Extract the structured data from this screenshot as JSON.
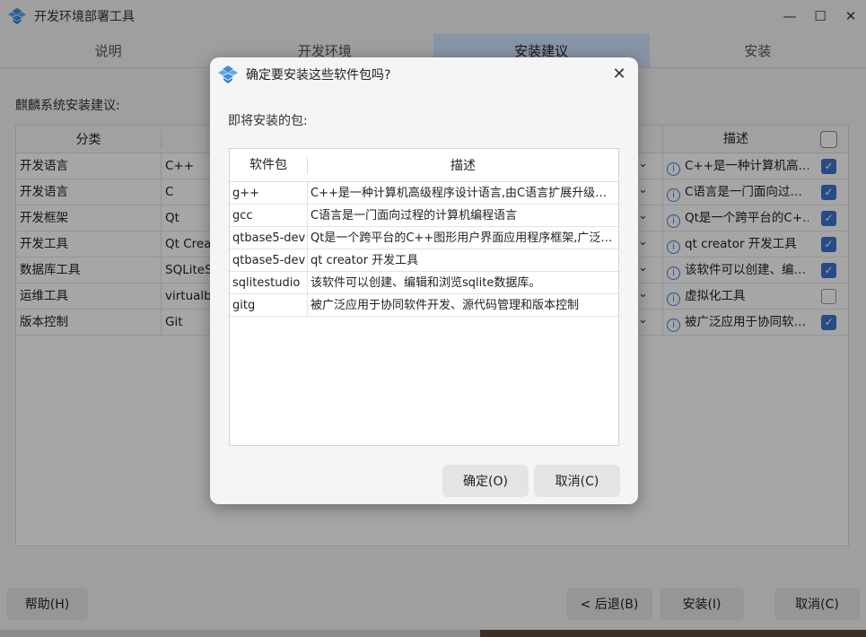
{
  "window": {
    "title": "开发环境部署工具"
  },
  "tabs": [
    {
      "label": "说明"
    },
    {
      "label": "开发环境"
    },
    {
      "label": "安装建议"
    },
    {
      "label": "安装"
    }
  ],
  "section_label": "麒麟系统安装建议:",
  "grid": {
    "headers": {
      "category": "分类",
      "description": "描述"
    },
    "rows": [
      {
        "category": "开发语言",
        "software": "C++",
        "desc": "C++是一种计算机高…",
        "checked": true
      },
      {
        "category": "开发语言",
        "software": "C",
        "desc": "C语言是一门面向过…",
        "checked": true
      },
      {
        "category": "开发框架",
        "software": "Qt",
        "desc": "Qt是一个跨平台的C+…",
        "checked": true
      },
      {
        "category": "开发工具",
        "software": "Qt Creat",
        "desc": "qt creator 开发工具",
        "checked": true
      },
      {
        "category": "数据库工具",
        "software": "SQLiteSt",
        "desc": "该软件可以创建、编…",
        "checked": true
      },
      {
        "category": "运维工具",
        "software": "virtualbo",
        "desc": "虚拟化工具",
        "checked": false
      },
      {
        "category": "版本控制",
        "software": "Git",
        "desc": "被广泛应用于协同软…",
        "checked": true
      }
    ]
  },
  "buttons": {
    "help": "帮助(H)",
    "back": "< 后退(B)",
    "install": "安装(I)",
    "cancel": "取消(C)"
  },
  "dialog": {
    "title": "确定要安装这些软件包吗?",
    "label": "即将安装的包:",
    "headers": {
      "package": "软件包",
      "description": "描述"
    },
    "rows": [
      {
        "package": "g++",
        "desc": "C++是一种计算机高级程序设计语言,由C语言扩展升级…"
      },
      {
        "package": "gcc",
        "desc": "C语言是一门面向过程的计算机编程语言"
      },
      {
        "package": "qtbase5-dev",
        "desc": "Qt是一个跨平台的C++图形用户界面应用程序框架,广泛…"
      },
      {
        "package": "qtbase5-dev",
        "desc": "qt creator 开发工具"
      },
      {
        "package": "sqlitestudio",
        "desc": "该软件可以创建、编辑和浏览sqlite数据库。"
      },
      {
        "package": "gitg",
        "desc": "被广泛应用于协同软件开发、源代码管理和版本控制"
      }
    ],
    "ok": "确定(O)",
    "cancel": "取消(C)"
  },
  "colors": {
    "accent": "#3d73cc",
    "active_tab": "#cfe3ff"
  }
}
